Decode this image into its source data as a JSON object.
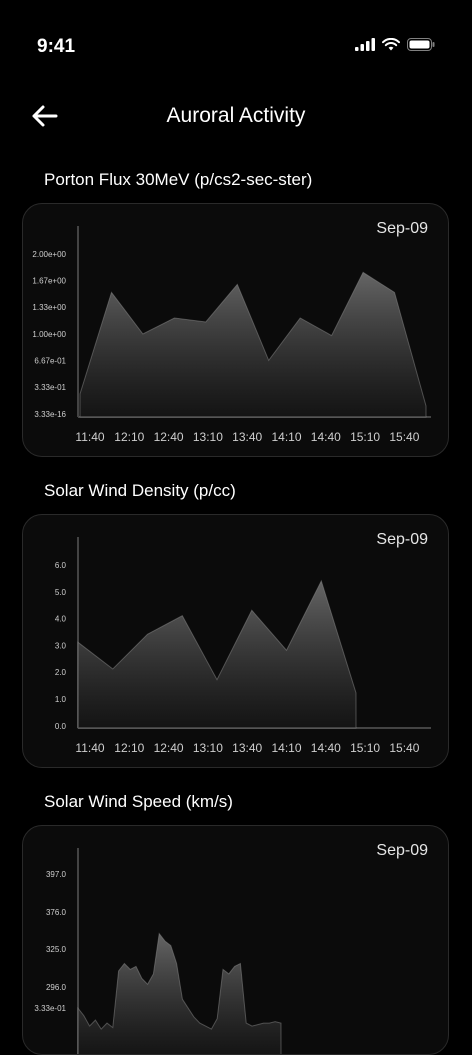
{
  "status": {
    "time": "9:41"
  },
  "header": {
    "title": "Auroral Activity"
  },
  "charts": [
    {
      "section_title": "Porton Flux 30MeV (p/cs2-sec-ster)",
      "date": "Sep-09",
      "y_ticks": [
        "2.00e+00",
        "1.67e+00",
        "1.33e+00",
        "1.00e+00",
        "6.67e-01",
        "3.33e-01",
        "3.33e-16"
      ],
      "x_ticks": [
        "11:40",
        "12:10",
        "12:40",
        "13:10",
        "13:40",
        "14:10",
        "14:40",
        "15:10",
        "15:40"
      ]
    },
    {
      "section_title": "Solar Wind Density (p/cc)",
      "date": "Sep-09",
      "y_ticks": [
        "6.0",
        "5.0",
        "4.0",
        "3.0",
        "2.0",
        "1.0",
        "0.0"
      ],
      "x_ticks": [
        "11:40",
        "12:10",
        "12:40",
        "13:10",
        "13:40",
        "14:10",
        "14:40",
        "15:10",
        "15:40"
      ]
    },
    {
      "section_title": "Solar Wind Speed (km/s)",
      "date": "Sep-09",
      "y_ticks": [
        "397.0",
        "376.0",
        "325.0",
        "296.0",
        "3.33e-01"
      ],
      "x_ticks": []
    }
  ],
  "chart_data": [
    {
      "type": "area",
      "ylim": [
        0,
        2.0
      ],
      "x": [
        "11:40",
        "12:10",
        "12:40",
        "13:10",
        "13:40",
        "14:10",
        "14:40",
        "15:10",
        "15:40"
      ],
      "series": [
        {
          "values": [
            0.25,
            1.52,
            1.0,
            1.2,
            1.15,
            1.62,
            0.67,
            1.2,
            0.98,
            1.77,
            1.52,
            0.1
          ]
        }
      ]
    },
    {
      "type": "area",
      "ylim": [
        0,
        6.0
      ],
      "x": [
        "11:40",
        "12:10",
        "12:40",
        "13:10",
        "13:40",
        "14:10",
        "14:40",
        "15:10",
        "15:40"
      ],
      "series": [
        {
          "values": [
            3.1,
            2.1,
            3.4,
            4.1,
            1.7,
            4.3,
            2.8,
            5.4,
            1.2
          ]
        }
      ]
    },
    {
      "type": "area",
      "ylim": [
        290,
        400
      ],
      "series": [
        {
          "values": [
            310,
            305,
            298,
            302,
            296,
            300,
            297,
            335,
            340,
            336,
            338,
            330,
            326,
            333,
            360,
            355,
            352,
            340,
            316,
            310,
            304,
            300,
            298,
            296,
            303,
            336,
            333,
            338,
            340,
            300,
            298,
            299,
            300,
            300,
            301,
            300
          ]
        }
      ]
    }
  ]
}
